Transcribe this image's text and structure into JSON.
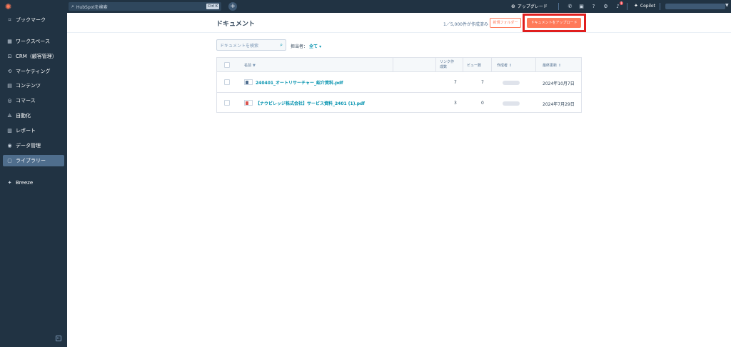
{
  "sidebar": {
    "items": [
      {
        "label": "ブックマーク",
        "icon": "bookmark-icon",
        "glyph": "⌑"
      },
      {
        "label": "ワークスペース",
        "icon": "workspace-icon",
        "glyph": "▦"
      },
      {
        "label": "CRM（顧客管理）",
        "icon": "crm-icon",
        "glyph": "⊡"
      },
      {
        "label": "マーケティング",
        "icon": "marketing-icon",
        "glyph": "⟲"
      },
      {
        "label": "コンテンツ",
        "icon": "content-icon",
        "glyph": "▤"
      },
      {
        "label": "コマース",
        "icon": "commerce-icon",
        "glyph": "◎"
      },
      {
        "label": "自動化",
        "icon": "automation-icon",
        "glyph": "⟁"
      },
      {
        "label": "レポート",
        "icon": "report-icon",
        "glyph": "▥"
      },
      {
        "label": "データ管理",
        "icon": "data-management-icon",
        "glyph": "◉"
      },
      {
        "label": "ライブラリー",
        "icon": "library-icon",
        "glyph": "▢"
      },
      {
        "label": "Breeze",
        "icon": "breeze-icon",
        "glyph": "✦"
      }
    ]
  },
  "topbar": {
    "search_placeholder": "HubSpotを検索",
    "search_shortcut": "Ctrl K",
    "upgrade_label": "アップグレード",
    "copilot_label": "Copilot",
    "notification_count": "1"
  },
  "main": {
    "title": "ドキュメント",
    "count_text": "1／5,000件が作成済み",
    "new_folder_label": "新規フォルダー",
    "upload_label": "ドキュメントをアップロード",
    "search_placeholder": "ドキュメントを検索",
    "owner_filter_label": "担当者：",
    "owner_filter_value": "全て"
  },
  "table": {
    "headers": {
      "name": "名前",
      "link_count": "リンク作成数",
      "view_count": "ビュー数",
      "creator": "作成者",
      "updated": "最終更新"
    },
    "rows": [
      {
        "name": "240401_オートリサーチャー_紹介資料.pdf",
        "links": "7",
        "views": "7",
        "updated": "2024年10月7日"
      },
      {
        "name": "【ナウビレッジ株式会社】サービス資料_2401 (1).pdf",
        "links": "3",
        "views": "0",
        "updated": "2024年7月29日"
      }
    ]
  },
  "colors": {
    "sidebar_bg": "#213343",
    "accent": "#ff7a59",
    "link": "#0091ae",
    "highlight": "#e01e1e"
  }
}
